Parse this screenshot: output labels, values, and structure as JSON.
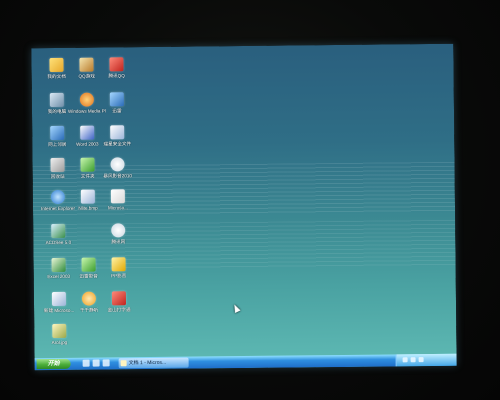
{
  "desktop": {
    "icons": [
      {
        "label": "我的文档"
      },
      {
        "label": "QQ游戏"
      },
      {
        "label": "腾讯QQ"
      },
      {
        "label": "我的电脑"
      },
      {
        "label": "Windows Media Player"
      },
      {
        "label": "迅雷"
      },
      {
        "label": "网上邻居"
      },
      {
        "label": "Word 2003"
      },
      {
        "label": "瑞星安全文件"
      },
      {
        "label": "回收站"
      },
      {
        "label": "文件夹"
      },
      {
        "label": "暴风影音2010"
      },
      {
        "label": "Internet Explorer"
      },
      {
        "label": "Nlite.bmp"
      },
      {
        "label": "Microso..."
      },
      {
        "label": "ACDSee 5.0"
      },
      {
        "label": "腾讯网"
      },
      {
        "label": "Excel 2003"
      },
      {
        "label": "迅雷影音"
      },
      {
        "label": "PP影音"
      },
      {
        "label": "新建 Microso..."
      },
      {
        "label": "千千静听"
      },
      {
        "label": "金山打字通"
      },
      {
        "label": "Arol.jpg"
      }
    ]
  },
  "taskbar": {
    "start_label": "开始",
    "task_label": "文档 1 - Micros...",
    "clock": ""
  }
}
